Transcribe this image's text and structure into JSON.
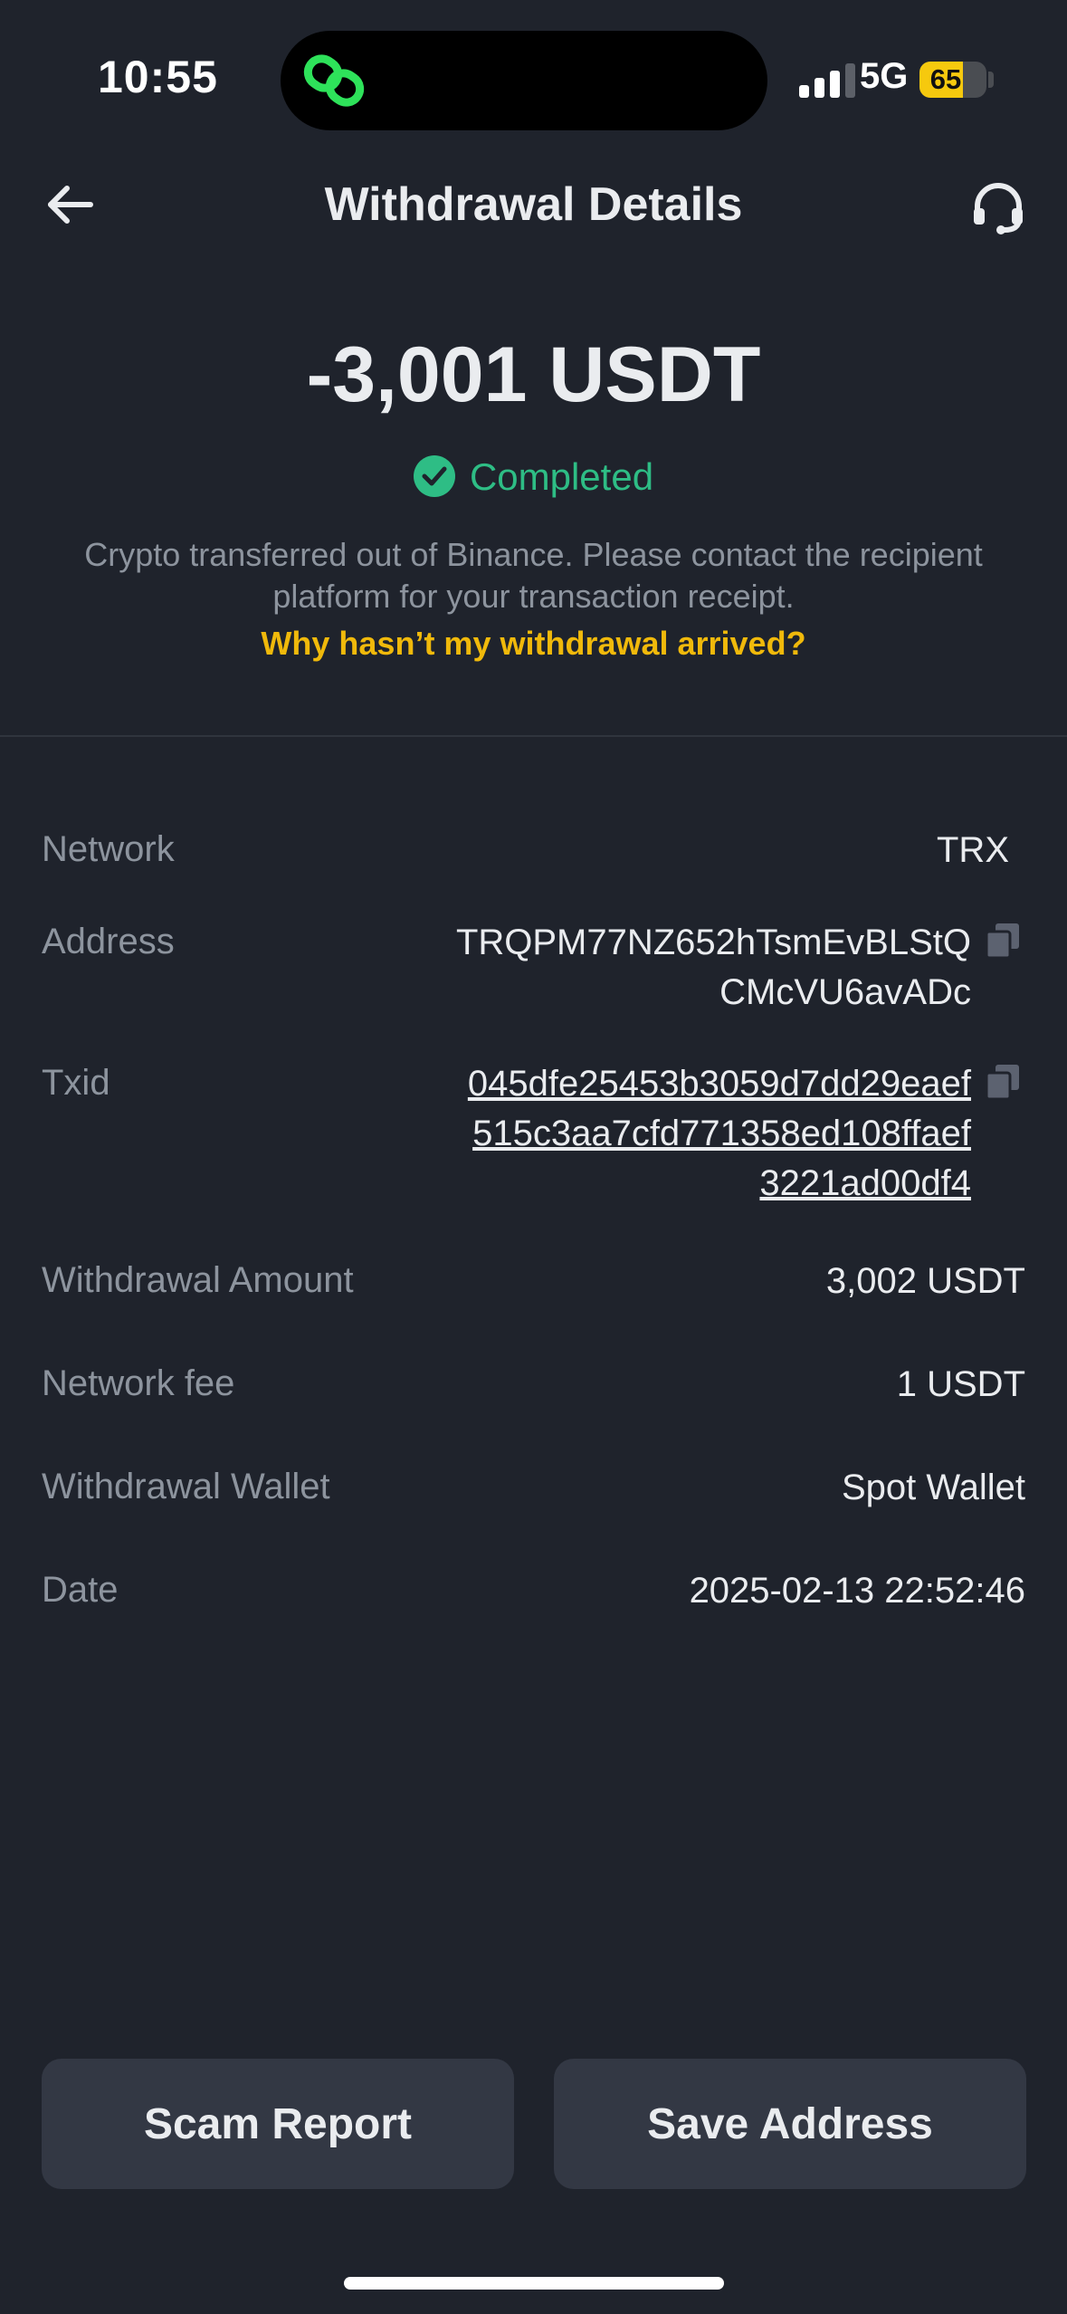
{
  "status_bar": {
    "time": "10:55",
    "network": "5G",
    "battery": {
      "level": 65,
      "label": "65",
      "color": "#f6c90e"
    }
  },
  "header": {
    "title": "Withdrawal Details",
    "back_icon": "arrow-left-icon",
    "support_icon": "headset-icon"
  },
  "summary": {
    "amount": "-3,001 USDT",
    "status": "Completed",
    "status_color": "#2ebd85",
    "notice": "Crypto transferred out of Binance. Please contact the recipient platform for your transaction receipt.",
    "help_link": "Why hasn’t my withdrawal arrived?",
    "link_color": "#f0b90b"
  },
  "details": {
    "network": {
      "label": "Network",
      "value": "TRX"
    },
    "address": {
      "label": "Address",
      "line1": "TRQPM77NZ652hTsmEvBLStQ",
      "line2": "CMcVU6avADc"
    },
    "txid": {
      "label": "Txid",
      "line1": "045dfe25453b3059d7dd29eaef",
      "line2": "515c3aa7cfd771358ed108ffaef",
      "line3": "3221ad00df4"
    },
    "withdrawal_amount": {
      "label": "Withdrawal Amount",
      "value": "3,002 USDT"
    },
    "network_fee": {
      "label": "Network fee",
      "value": "1 USDT"
    },
    "withdrawal_wallet": {
      "label": "Withdrawal Wallet",
      "value": "Spot Wallet"
    },
    "date": {
      "label": "Date",
      "value": "2025-02-13 22:52:46"
    }
  },
  "actions": {
    "scam_report": "Scam Report",
    "save_address": "Save Address"
  }
}
